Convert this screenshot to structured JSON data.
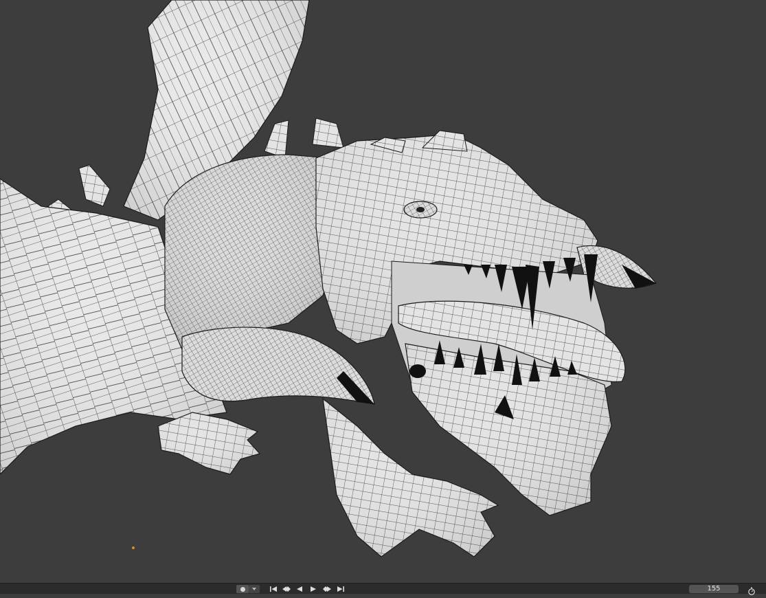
{
  "timeline": {
    "current_frame": "155",
    "playback_controls": [
      "jump-to-start",
      "jump-to-previous-keyframe",
      "play-reverse",
      "play",
      "jump-to-next-keyframe",
      "jump-to-end"
    ],
    "keyframe_icon": "record-dot-icon",
    "timer_icon": "stopwatch-icon"
  },
  "viewport": {
    "background_color": "#3d3d3d",
    "mesh_color": "#e6e6e6",
    "wire_color": "#1a1a1a",
    "subject": "dragon-wireframe-mesh"
  },
  "colors": {
    "origin_marker": "#d98a2c",
    "timeline_bg": "#2b2b2b"
  }
}
